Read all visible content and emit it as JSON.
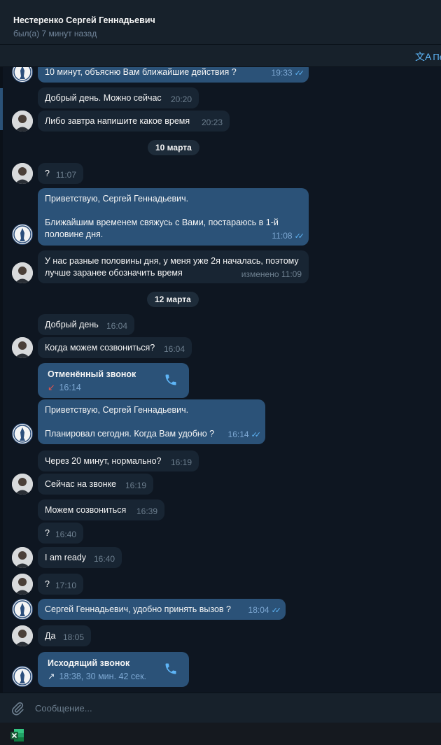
{
  "header": {
    "title": "Нестеренко Сергей Геннадьевич",
    "status": "был(а) 7 минут назад"
  },
  "translate": {
    "icon": "translate-icon",
    "label": "Пе"
  },
  "dates": [
    "10 марта",
    "12 марта"
  ],
  "messages": [
    {
      "text": "10 минут, объясню Вам ближайшие действия ?",
      "time": "19:33"
    },
    {
      "text": "Добрый день. Можно сейчас",
      "time": "20:20"
    },
    {
      "text": "Либо завтра напишите какое время",
      "time": "20:23"
    },
    {
      "text": "?",
      "time": "11:07"
    },
    {
      "text": "Приветствую, Сергей Геннадьевич.\n\nБлижайшим временем свяжусь с Вами, постараюсь в 1-й половине дня.",
      "time": "11:08"
    },
    {
      "text": "У нас разные половины дня, у меня уже 2я началась, поэтому лучше заранее обозначить время",
      "time": "изменено 11:09"
    },
    {
      "text": "Добрый день",
      "time": "16:04"
    },
    {
      "text": "Когда можем созвониться?",
      "time": "16:04"
    },
    {
      "text": "Приветствую, Сергей Геннадьевич.\n\nПланировал сегодня. Когда Вам удобно ?",
      "time": "16:14"
    },
    {
      "text": "Через 20 минут, нормально?",
      "time": "16:19"
    },
    {
      "text": "Сейчас на звонке",
      "time": "16:19"
    },
    {
      "text": "Можем созвониться",
      "time": "16:39"
    },
    {
      "text": "?",
      "time": "16:40"
    },
    {
      "text": "I am ready",
      "time": "16:40"
    },
    {
      "text": "?",
      "time": "17:10"
    },
    {
      "text": "Сергей Геннадьевич, удобно принять вызов ?",
      "time": "18:04"
    },
    {
      "text": "Да",
      "time": "18:05"
    }
  ],
  "calls": [
    {
      "title": "Отменённый звонок",
      "arrow": "↙",
      "info": "16:14"
    },
    {
      "title": "Исходящий звонок",
      "arrow": "↗",
      "info": "18:38, 30 мин. 42 сек."
    }
  ],
  "composer": {
    "placeholder": "Сообщение..."
  },
  "colors": {
    "background": "#0e1621",
    "incoming": "#182533",
    "outgoing": "#2b5278",
    "accent": "#5eb5f7",
    "missed": "#e5534b"
  },
  "icons": {
    "attach": "paperclip-icon",
    "phone": "phone-icon",
    "read": "double-check-icon",
    "taskbar": "excel-icon"
  }
}
